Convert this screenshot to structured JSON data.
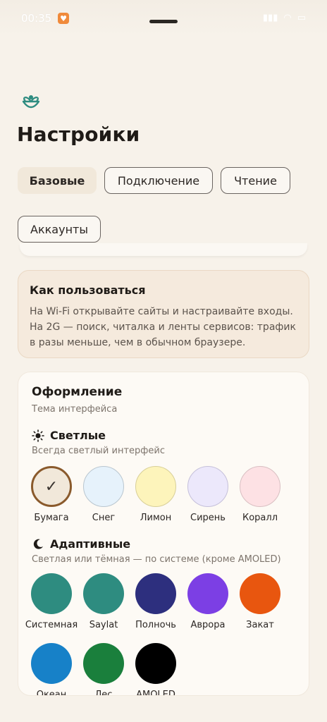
{
  "status": {
    "time": "00:35"
  },
  "page_title": "Настройки",
  "tabs": [
    {
      "label": "Базовые",
      "active": true
    },
    {
      "label": "Подключение",
      "active": false
    },
    {
      "label": "Чтение",
      "active": false
    },
    {
      "label": "Аккаунты",
      "active": false
    }
  ],
  "how_to": {
    "title": "Как пользоваться",
    "text": "На Wi-Fi открывайте сайты и настраивайте входы. На 2G — поиск, читалка и ленты сервисов: трафик в разы меньше, чем в обычном браузере."
  },
  "appearance": {
    "title": "Оформление",
    "subtitle": "Тема интерфейса",
    "light": {
      "title": "Светлые",
      "subtitle": "Всегда светлый интерфейс",
      "icon": "sun-icon",
      "themes": [
        {
          "name": "Бумага",
          "color": "#f1e8da",
          "selected": true
        },
        {
          "name": "Снег",
          "color": "#e6f2fb",
          "selected": false
        },
        {
          "name": "Лимон",
          "color": "#fdf4bb",
          "selected": false
        },
        {
          "name": "Сирень",
          "color": "#ece8fb",
          "selected": false
        },
        {
          "name": "Коралл",
          "color": "#fde1e4",
          "selected": false
        }
      ]
    },
    "adaptive": {
      "title": "Адаптивные",
      "subtitle": "Светлая или тёмная — по системе (кроме AMOLED)",
      "icon": "moon-icon",
      "themes": [
        {
          "name": "Системная",
          "color": "#2e8c80"
        },
        {
          "name": "Saylat",
          "color": "#2e8c80"
        },
        {
          "name": "Полночь",
          "color": "#2d2f7e"
        },
        {
          "name": "Аврора",
          "color": "#7c3fe4"
        },
        {
          "name": "Закат",
          "color": "#e8560f"
        },
        {
          "name": "Океан",
          "color": "#1781c8"
        },
        {
          "name": "Лес",
          "color": "#1a7f3c"
        },
        {
          "name": "AMOLED",
          "color": "#000000"
        }
      ]
    }
  }
}
